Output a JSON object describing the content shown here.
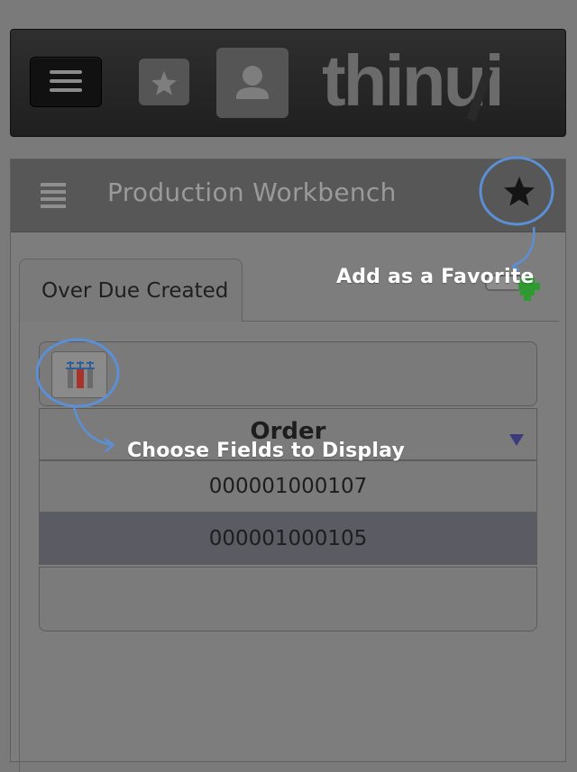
{
  "header": {
    "menu_icon": "hamburger-icon",
    "favorites_icon": "star-icon",
    "user_icon": "user-icon",
    "logo_text": "thinui"
  },
  "panel": {
    "title": "Production Workbench",
    "list_icon": "list-icon",
    "favorite_icon": "star-icon"
  },
  "tabs": [
    {
      "label": "Over Due Created",
      "active": true
    }
  ],
  "grid": {
    "fields_button_icon": "choose-fields-icon",
    "column_header": "Order",
    "rows": [
      "000001000107",
      "000001000105"
    ],
    "selected_row": 1
  },
  "annotations": {
    "favorite_callout": "Add as a Favorite",
    "fields_callout": "Choose Fields to Display",
    "callout_color": "#5b8fd6"
  }
}
